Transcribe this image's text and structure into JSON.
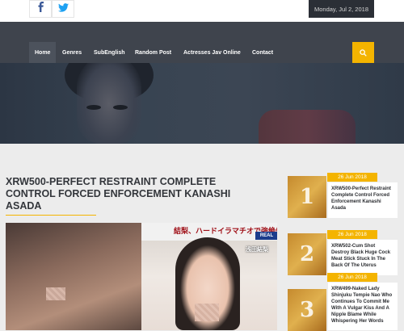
{
  "header": {
    "social": [
      {
        "icon": "facebook-icon"
      },
      {
        "icon": "twitter-icon"
      }
    ],
    "date": "Monday, Jul 2, 2018"
  },
  "nav": {
    "items": [
      "Home",
      "Genres",
      "SubEnglish",
      "Random Post",
      "Actresses Jav Online",
      "Contact"
    ],
    "active": "Home",
    "search_icon": "search-icon"
  },
  "post": {
    "title": "XRW500-Perfect Restraint Complete Control Forced Enforcement Kanashi Asada"
  },
  "cover": {
    "banner_text": "結梨、ハードイラマチオで強絶失禁!!",
    "logo_text": "REAL",
    "name_text": "浅田結梨"
  },
  "sidebar": {
    "items": [
      {
        "number": "1",
        "date": "26 Jun 2018",
        "title": "XRW500-Perfect Restraint Complete Control Forced Enforcement Kanashi Asada"
      },
      {
        "number": "2",
        "date": "26 Jun 2018",
        "title": "XRW502-Cum Shot Destroy Black Huge Cock Meat Stick Stuck In The Back Of The Uterus"
      },
      {
        "number": "3",
        "date": "26 Jun 2018",
        "title": "XRW499-Naked Lady Shinjuku Tempie Nao Who Continues To Commit Me With A Vulgar Kiss And A Nipple Blame While Whispering Her Words"
      }
    ]
  },
  "colors": {
    "accent": "#f4b400",
    "nav_bg": "#3f444d",
    "date_bg": "#2b2f36"
  }
}
